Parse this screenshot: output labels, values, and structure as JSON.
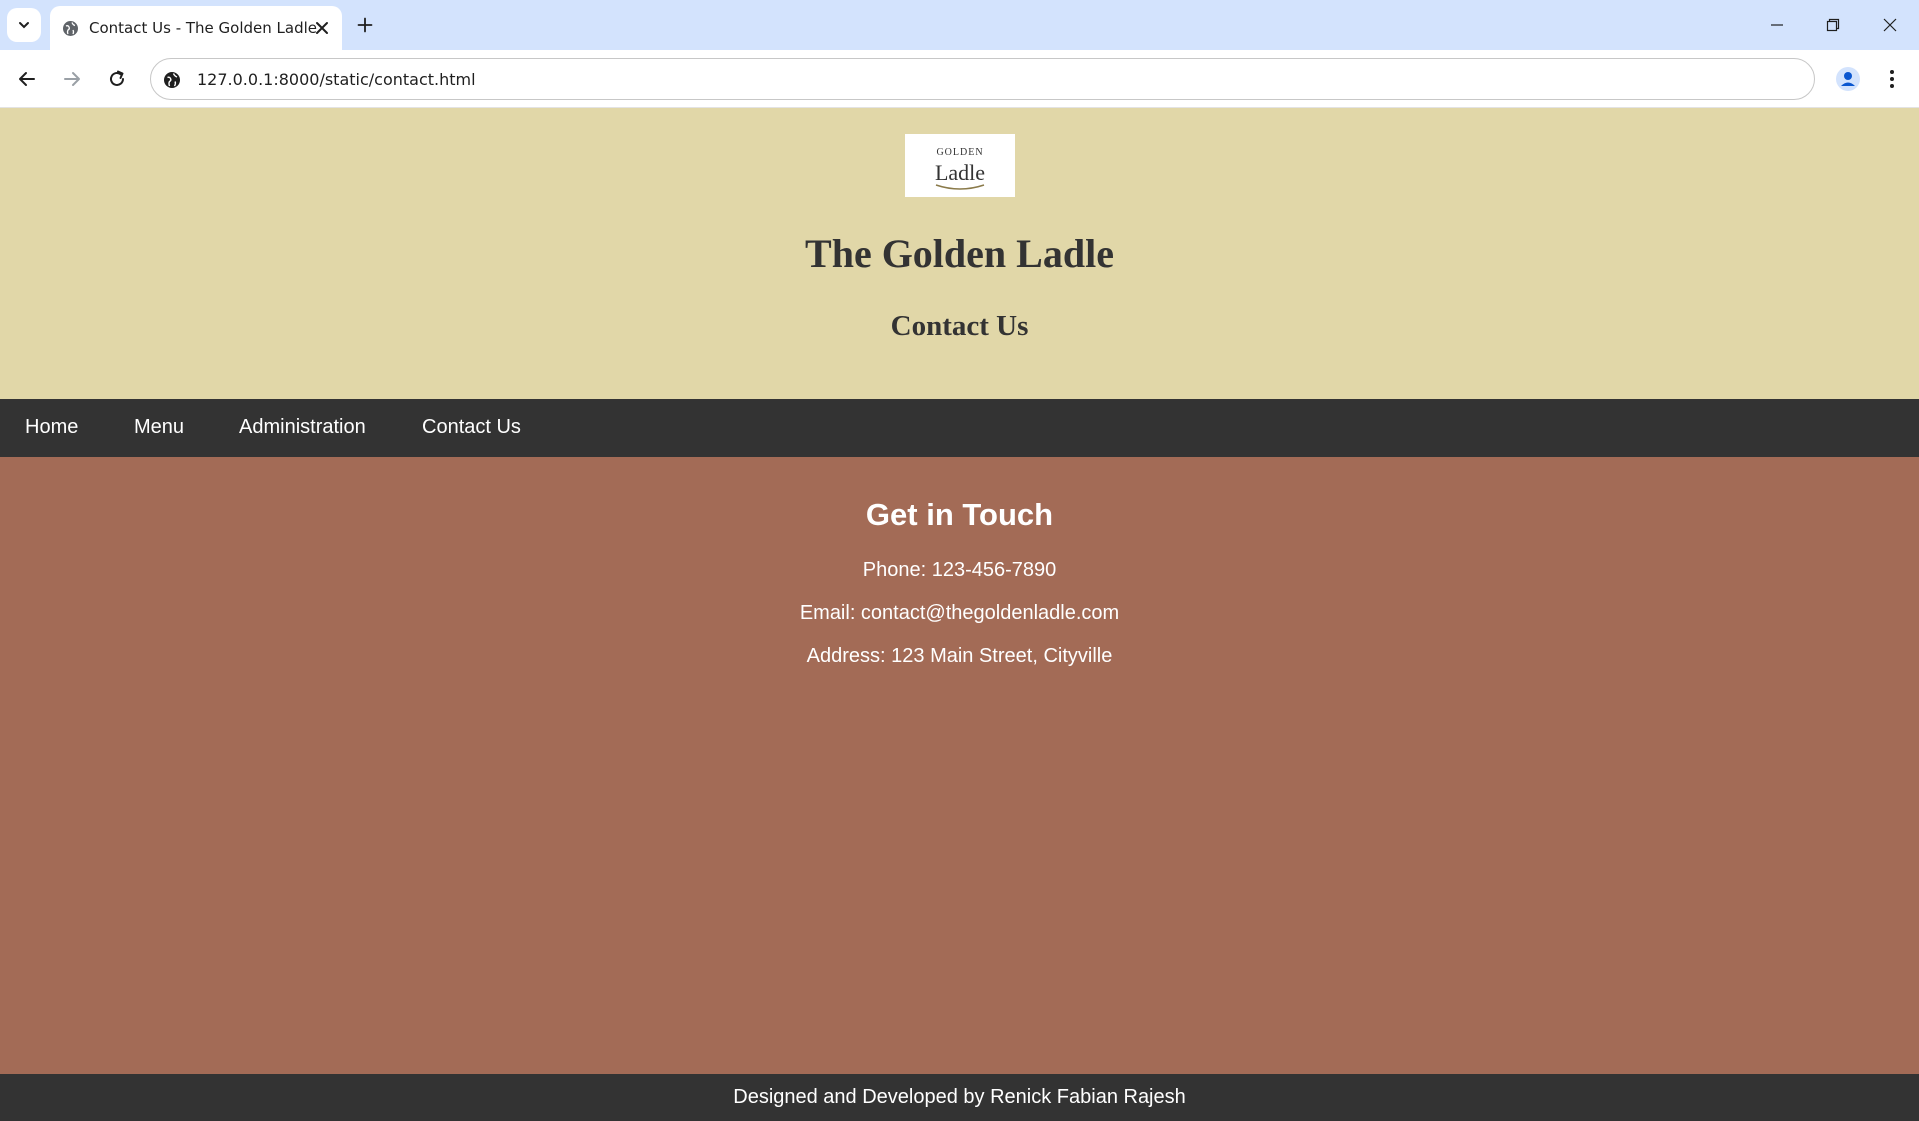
{
  "browser": {
    "tab": {
      "title": "Contact Us - The Golden Ladle",
      "favicon": "globe-icon"
    },
    "address_bar": {
      "url": "127.0.0.1:8000/static/contact.html",
      "site_info_icon": "site-info-icon"
    },
    "colors": {
      "tabstrip": "#d3e3fd",
      "toolbar": "#ffffff"
    }
  },
  "page": {
    "logo": {
      "text_top": "GOLDEN",
      "text_bottom": "Ladle"
    },
    "site_title": "The Golden Ladle",
    "page_subtitle": "Contact Us",
    "nav": {
      "items": [
        {
          "label": "Home"
        },
        {
          "label": "Menu"
        },
        {
          "label": "Administration"
        },
        {
          "label": "Contact Us"
        }
      ]
    },
    "contact": {
      "heading": "Get in Touch",
      "phone": "Phone: 123-456-7890",
      "email": "Email: contact@thegoldenladle.com",
      "address": "Address: 123 Main Street, Cityville"
    },
    "footer": {
      "credit": "Designed and Developed by Renick Fabian Rajesh"
    },
    "colors": {
      "header_bg": "#e1d7a8",
      "nav_bg": "#333333",
      "body_bg": "#a36b56",
      "footer_bg": "#333333",
      "text_dark": "#333333",
      "text_light": "#ffffff"
    }
  }
}
